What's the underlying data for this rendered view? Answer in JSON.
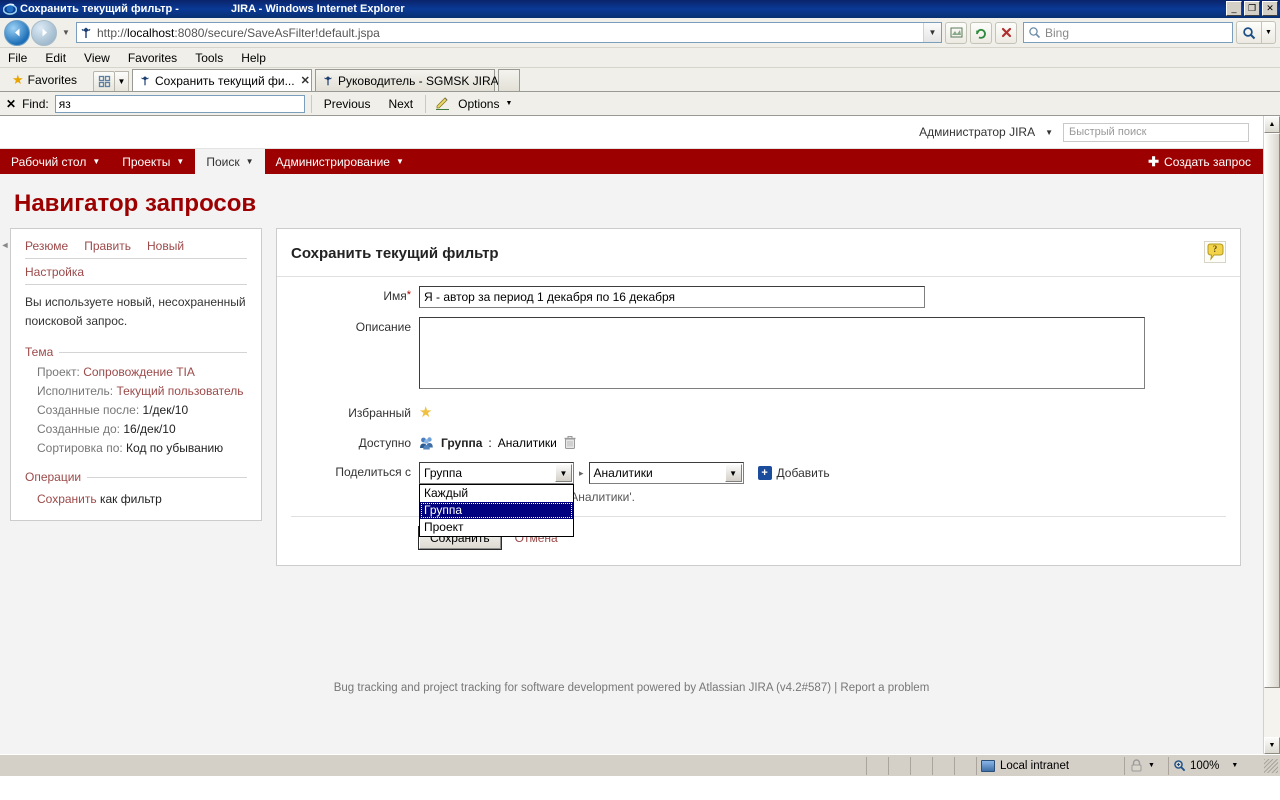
{
  "window": {
    "title_left": "Сохранить текущий фильтр -",
    "title_right": "JIRA - Windows Internet Explorer",
    "minimize": "_",
    "maximize": "❐",
    "close": "✕"
  },
  "address_bar": {
    "url_scheme": "http://",
    "url_host": "localhost",
    "url_rest": ":8080/secure/SaveAsFilter!default.jspa",
    "url_full": "http://localhost:8080/secure/SaveAsFilter!default.jspa",
    "search_placeholder": "Bing",
    "back_icon": "◄",
    "forward_icon": "►",
    "compat_icon": "compatibility-view-icon",
    "refresh_icon": "↻",
    "stop_icon": "✕"
  },
  "menu": {
    "items": [
      "File",
      "Edit",
      "View",
      "Favorites",
      "Tools",
      "Help"
    ]
  },
  "favorites_bar": {
    "label": "Favorites"
  },
  "browser_tabs": [
    {
      "label": "Сохранить текущий фи...",
      "active": true,
      "close": "✕"
    },
    {
      "label": "Руководитель - SGMSK JIRA",
      "active": false,
      "close": ""
    }
  ],
  "find_bar": {
    "close": "✕",
    "label": "Find:",
    "value": "яз",
    "previous": "Previous",
    "next": "Next",
    "options": "Options",
    "caret": "▼"
  },
  "jira": {
    "user_name": "Администратор JIRA",
    "user_caret": "▼",
    "quick_search_placeholder": "Быстрый поиск",
    "nav_items": [
      {
        "label": "Рабочий стол",
        "caret": "▼",
        "active": false
      },
      {
        "label": "Проекты",
        "caret": "▼",
        "active": false
      },
      {
        "label": "Поиск",
        "caret": "▼",
        "active": true
      },
      {
        "label": "Администрирование",
        "caret": "▼",
        "active": false
      }
    ],
    "create_issue": "Создать запрос",
    "create_plus": "✚",
    "page_title": "Навигатор запросов",
    "nav_bg": "#9c0000",
    "title_color": "#9c0000"
  },
  "sidebar": {
    "tabs": [
      "Резюме",
      "Править",
      "Новый"
    ],
    "sub_tab": "Настройка",
    "note": "Вы используете новый, несохраненный поисковой запрос.",
    "section_filter": "Тема",
    "criteria": [
      {
        "label": "Проект:",
        "value": "Сопровождение TIA",
        "style": "red"
      },
      {
        "label": "Исполнитель:",
        "value": "Текущий пользователь",
        "style": "red"
      },
      {
        "label": "Созданные после:",
        "value": "1/дек/10",
        "style": "dark"
      },
      {
        "label": "Созданные до:",
        "value": "16/дек/10",
        "style": "dark"
      },
      {
        "label": "Сортировка по:",
        "value": "Код по убыванию",
        "style": "dark"
      }
    ],
    "section_operations": "Операции",
    "operation_link_strong": "Сохранить",
    "operation_link_rest": " как фильтр",
    "collapse_arrow": "◄"
  },
  "form": {
    "heading": "Сохранить текущий фильтр",
    "help_icon": "help-icon",
    "name_label": "Имя",
    "name_required": "*",
    "name_value": "Я - автор за период 1 декабря по 16 декабря",
    "description_label": "Описание",
    "description_value": "",
    "favourite_label": "Избранный",
    "favourite_icon": "★",
    "shares_label": "Доступно",
    "share_entry_type": "Группа",
    "share_entry_sep": ": ",
    "share_entry_value": "Аналитики",
    "share_delete_icon": "trash-icon",
    "share_with_label": "Поделиться с",
    "share_type_selected": "Группа",
    "share_type_options": [
      "Каждый",
      "Группа",
      "Проект"
    ],
    "share_type_open": true,
    "share_value_selected": "Аналитики",
    "arrow_sep": "▸",
    "add_label": "Добавить",
    "add_plus": "+",
    "share_description": "Просмотр/доступ в группе 'Аналитики'.",
    "save_label": "Сохранить",
    "cancel_label": "Отмена"
  },
  "footer": {
    "text": "Bug tracking and project tracking for software development powered by Atlassian JIRA (v4.2#587) | Report a problem"
  },
  "status_bar": {
    "zone": "Local intranet",
    "zone_icon": "network-icon",
    "lock_icon": "lock-icon",
    "lock_caret": "▼",
    "zoom_icon": "zoom-icon",
    "zoom_level": "100%",
    "zoom_caret": "▼"
  }
}
